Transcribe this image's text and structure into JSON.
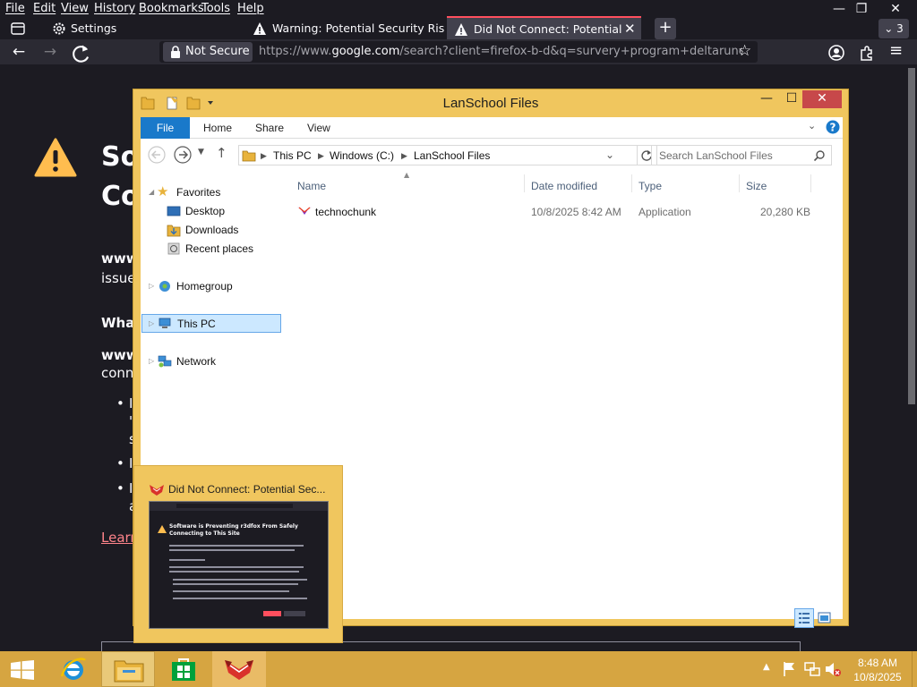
{
  "browser": {
    "menus": [
      "File",
      "Edit",
      "View",
      "History",
      "Bookmarks",
      "Tools",
      "Help"
    ],
    "tabs": [
      {
        "label": "Settings"
      },
      {
        "label": "Warning: Potential Security Risk"
      },
      {
        "label": "Did Not Connect: Potential Secu"
      }
    ],
    "tab_overflow_count": "3",
    "new_tab_label": "+",
    "not_secure_label": "Not Secure",
    "url_prefix": "https://www.",
    "url_host": "google.com",
    "url_rest": "/search?client=firefox-b-d&q=survery+program+deltarune+a",
    "accent_color": "#ff4f5e"
  },
  "error_page": {
    "title_line1": "So",
    "title_line2": "Co",
    "p1_bold": "www",
    "p1_rest": "issue",
    "heading2": "Wha",
    "p2_bold": "www",
    "p2_rest": "conne",
    "bullet1a": "I",
    "bullet1b": "\"",
    "bullet1c": "s",
    "bullet2": "I",
    "bullet3a": "I",
    "bullet3b": "a",
    "link": "Learn"
  },
  "explorer": {
    "title": "LanSchool Files",
    "ribbon_tabs": [
      "File",
      "Home",
      "Share",
      "View"
    ],
    "breadcrumb": [
      "This PC",
      "Windows (C:)",
      "LanSchool Files"
    ],
    "search_placeholder": "Search LanSchool Files",
    "nav": {
      "favorites": "Favorites",
      "desktop": "Desktop",
      "downloads": "Downloads",
      "recent": "Recent places",
      "homegroup": "Homegroup",
      "thispc": "This PC",
      "network": "Network"
    },
    "columns": [
      "Name",
      "Date modified",
      "Type",
      "Size"
    ],
    "files": [
      {
        "name": "technochunk",
        "date": "10/8/2025 8:42 AM",
        "type": "Application",
        "size": "20,280 KB"
      }
    ]
  },
  "preview": {
    "title": "Did Not Connect: Potential Sec...",
    "thumb_heading": "Software is Preventing r3dfox From Safely Connecting to This Site"
  },
  "taskbar": {
    "time": "8:48 AM",
    "date": "10/8/2025"
  }
}
